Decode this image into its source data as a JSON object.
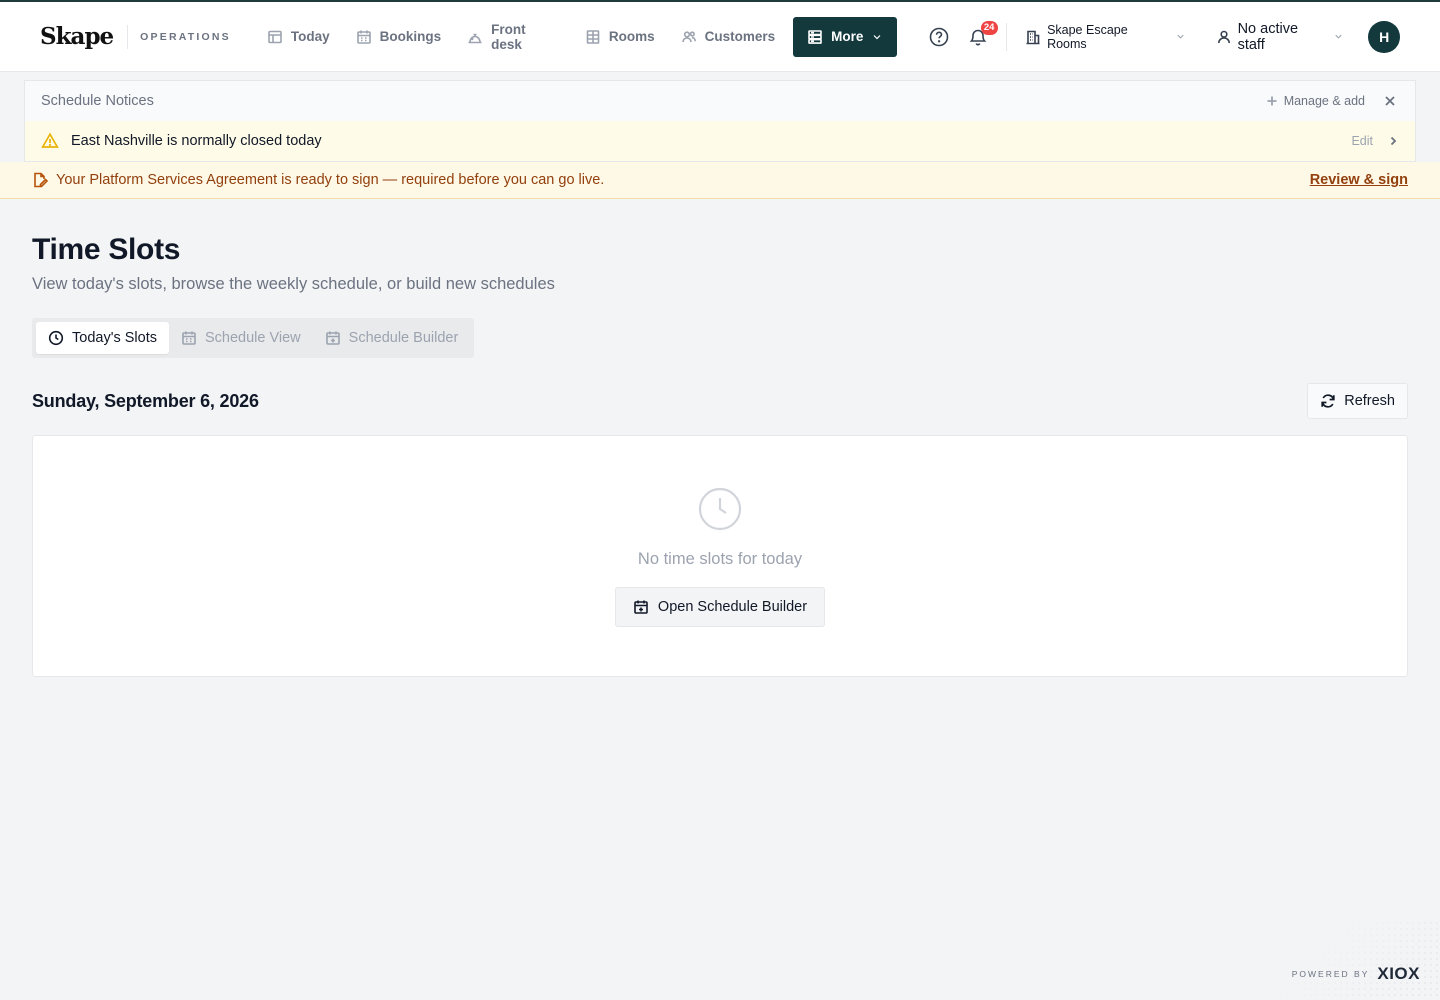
{
  "brand": {
    "logo": "Skape",
    "section": "OPERATIONS"
  },
  "nav": {
    "items": [
      {
        "label": "Today",
        "icon": "today-icon"
      },
      {
        "label": "Bookings",
        "icon": "calendar-icon"
      },
      {
        "label": "Front desk",
        "icon": "desk-bell-icon"
      },
      {
        "label": "Rooms",
        "icon": "grid-icon"
      },
      {
        "label": "Customers",
        "icon": "users-icon"
      }
    ],
    "more_label": "More"
  },
  "header": {
    "notifications_count": "24",
    "location": "Skape Escape Rooms",
    "staff": "No active staff",
    "avatar_initial": "H"
  },
  "notices": {
    "title": "Schedule Notices",
    "manage_label": "Manage & add",
    "items": [
      {
        "text": "East Nashville is normally closed today",
        "edit_label": "Edit"
      }
    ]
  },
  "agreement": {
    "text": "Your Platform Services Agreement is ready to sign — required before you can go live.",
    "link_label": "Review & sign"
  },
  "page": {
    "title": "Time Slots",
    "subtitle": "View today's slots, browse the weekly schedule, or build new schedules",
    "tabs": [
      {
        "label": "Today's Slots",
        "active": true
      },
      {
        "label": "Schedule View",
        "active": false
      },
      {
        "label": "Schedule Builder",
        "active": false
      }
    ],
    "date": "Sunday, September 6, 2026",
    "refresh_label": "Refresh",
    "empty_text": "No time slots for today",
    "open_builder_label": "Open Schedule Builder"
  },
  "footer": {
    "powered_label": "POWERED BY",
    "powered_brand": "XIOX"
  },
  "colors": {
    "primary": "#13393d",
    "badge": "#ef4444",
    "notice_bg": "#fefce8",
    "warning": "#eab308",
    "agreement_text": "#92400e"
  }
}
